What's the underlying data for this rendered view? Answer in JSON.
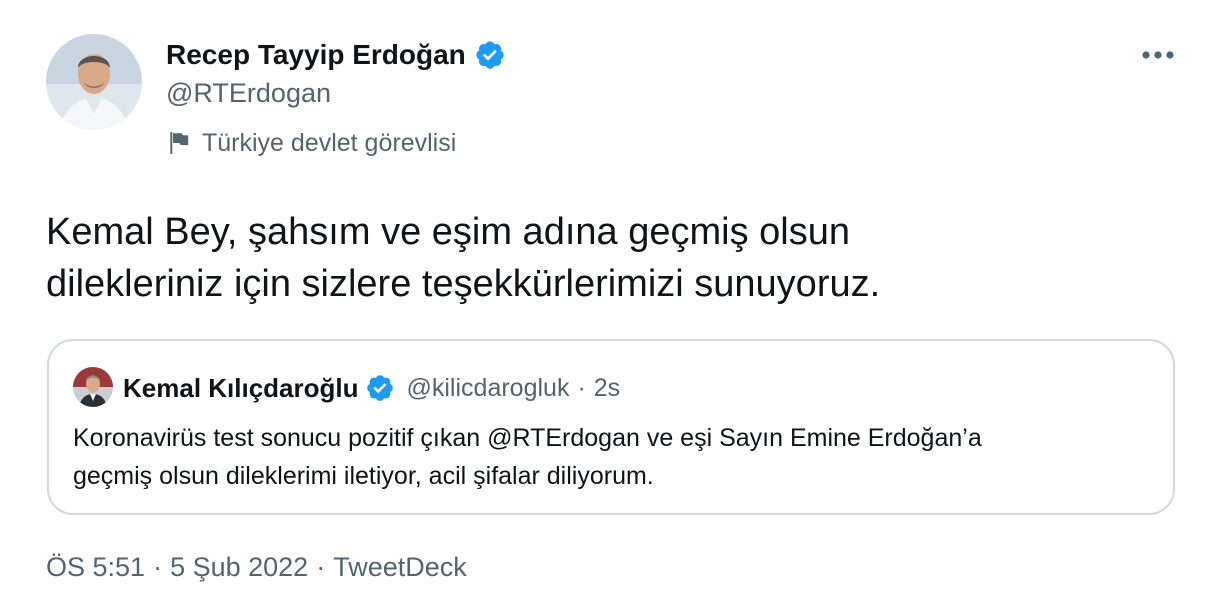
{
  "author": {
    "display_name": "Recep Tayyip Erdoğan",
    "handle": "@RTErdogan",
    "verified": true,
    "affiliation_label": "Türkiye devlet görevlisi",
    "avatar_icon": "profile-photo"
  },
  "menu": {
    "more_icon": "more-horizontal-icon"
  },
  "tweet": {
    "text_line1": "Kemal Bey, şahsım ve eşim adına geçmiş olsun",
    "text_line2": "dilekleriniz için sizlere teşekkürlerimizi sunuyoruz."
  },
  "quoted_tweet": {
    "display_name": "Kemal Kılıçdaroğlu",
    "handle": "@kilicdarogluk",
    "separator": "·",
    "time": "2s",
    "verified": true,
    "text_line1": "Koronavirüs test sonucu pozitif çıkan @RTErdogan ve eşi Sayın Emine Erdoğan’a",
    "text_line2": "geçmiş olsun dileklerimi iletiyor, acil şifalar diliyorum."
  },
  "meta": {
    "time": "ÖS 5:51",
    "separator": "·",
    "date": "5 Şub 2022",
    "source": "TweetDeck"
  },
  "colors": {
    "verified_blue": "#1d9bf0",
    "secondary_text": "#536471",
    "border": "#cfd9de"
  }
}
